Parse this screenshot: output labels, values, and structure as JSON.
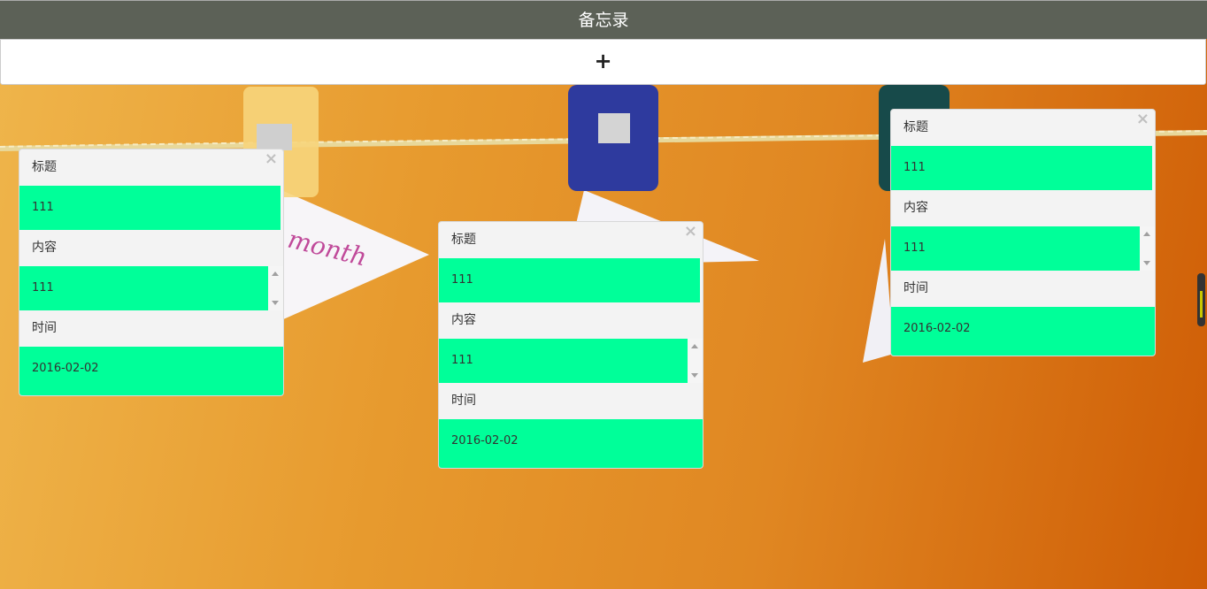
{
  "header": {
    "title": "备忘录"
  },
  "toolbar": {
    "add_label": "+"
  },
  "backdrop": {
    "card_text": "month"
  },
  "notes": [
    {
      "title_label": "标题",
      "title_value": "111",
      "content_label": "内容",
      "content_value": "111",
      "time_label": "时间",
      "time_value": "2016-02-02",
      "close": "×"
    },
    {
      "title_label": "标题",
      "title_value": "111",
      "content_label": "内容",
      "content_value": "111",
      "time_label": "时间",
      "time_value": "2016-02-02",
      "close": "×"
    },
    {
      "title_label": "标题",
      "title_value": "111",
      "content_label": "内容",
      "content_value": "111",
      "time_label": "时间",
      "time_value": "2016-02-02",
      "close": "×"
    }
  ],
  "colors": {
    "header_bg": "#5c6157",
    "field_bg": "#00ff99",
    "panel_bg": "#f3f3f3"
  }
}
